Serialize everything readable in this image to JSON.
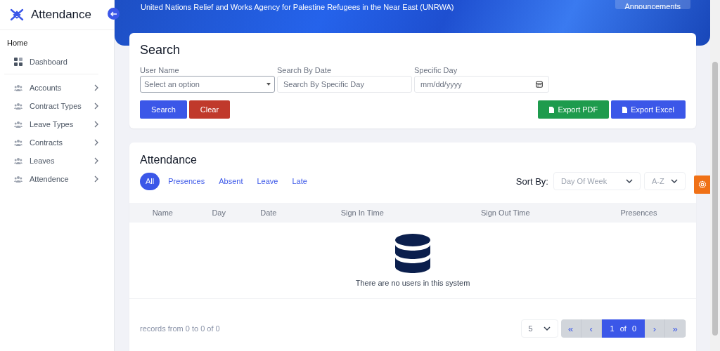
{
  "sidebar": {
    "title": "Attendance",
    "section": "Home",
    "items": [
      {
        "label": "Dashboard",
        "kind": "link"
      },
      {
        "label": "Accounts",
        "kind": "group",
        "expanded": false
      },
      {
        "label": "Contract Types",
        "kind": "group",
        "expanded": false
      },
      {
        "label": "Leave Types",
        "kind": "group",
        "expanded": false
      },
      {
        "label": "Contracts",
        "kind": "group",
        "expanded": false
      },
      {
        "label": "Leaves",
        "kind": "group",
        "expanded": false
      },
      {
        "label": "Attendence",
        "kind": "group",
        "expanded": false
      }
    ]
  },
  "banner": {
    "organization": "United Nations Relief and Works Agency for Palestine Refugees in the Near East (UNRWA)",
    "button": "Announcements"
  },
  "search": {
    "title": "Search",
    "fields": [
      {
        "label": "User Name",
        "placeholder": "Select an option",
        "kind": "select"
      },
      {
        "label": "Search By Date",
        "placeholder": "Search By Specific Day",
        "kind": "text"
      },
      {
        "label": "Specific Day",
        "placeholder": "mm/dd/yyyy",
        "kind": "date"
      }
    ],
    "buttons": [
      {
        "label": "Search",
        "kind": "primary"
      },
      {
        "label": "Clear",
        "kind": "danger"
      }
    ],
    "exports": [
      {
        "label": "Export PDF",
        "kind": "success"
      },
      {
        "label": "Export Excel",
        "kind": "primary"
      }
    ]
  },
  "attendance": {
    "title": "Attendance",
    "filters": [
      {
        "label": "All",
        "selected": true
      },
      {
        "label": "Presences",
        "selected": false
      },
      {
        "label": "Absent",
        "selected": false
      },
      {
        "label": "Leave",
        "selected": false
      },
      {
        "label": "Late",
        "selected": false
      }
    ],
    "sort_label": "Sort By:",
    "sort": [
      "Day Of Week",
      "A-Z"
    ],
    "columns": [
      "Name",
      "Day",
      "Date",
      "Sign In Time",
      "Sign Out Time",
      "Presences"
    ],
    "empty_message": "There are no users in this system",
    "records": "records from 0 to 0 of 0",
    "page_size": "5",
    "pagination": {
      "first": "«",
      "prev": "‹",
      "current": "1",
      "of": "of",
      "total": "0",
      "next": "›",
      "last": "»"
    }
  }
}
